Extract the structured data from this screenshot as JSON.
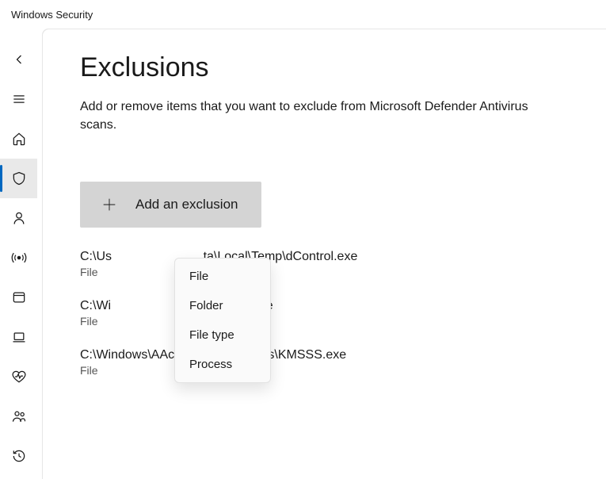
{
  "window": {
    "title": "Windows Security"
  },
  "sidebar": {
    "items": [
      {
        "name": "back",
        "icon": "arrow-left"
      },
      {
        "name": "menu",
        "icon": "menu"
      },
      {
        "name": "home",
        "icon": "home"
      },
      {
        "name": "virus-protection",
        "icon": "shield",
        "active": true
      },
      {
        "name": "account-protection",
        "icon": "person"
      },
      {
        "name": "firewall",
        "icon": "signal"
      },
      {
        "name": "app-browser",
        "icon": "window"
      },
      {
        "name": "device-security",
        "icon": "laptop"
      },
      {
        "name": "device-performance",
        "icon": "heart"
      },
      {
        "name": "family-options",
        "icon": "people"
      },
      {
        "name": "protection-history",
        "icon": "history"
      }
    ]
  },
  "page": {
    "title": "Exclusions",
    "description": "Add or remove items that you want to exclude from Microsoft Defender Antivirus scans."
  },
  "add_button": {
    "label": "Add an exclusion"
  },
  "dropdown": {
    "items": [
      {
        "label": "File"
      },
      {
        "label": "Folder"
      },
      {
        "label": "File type"
      },
      {
        "label": "Process"
      }
    ]
  },
  "exclusions": [
    {
      "path": "C:\\Users\\...\\AppData\\Local\\Temp\\dControl.exe",
      "type": "File"
    },
    {
      "path": "C:\\Windows\\AAct_Tools\\AAct.exe",
      "type": "File"
    },
    {
      "path": "C:\\Windows\\AAct_Tools\\AAct_files\\KMSSS.exe",
      "type": "File"
    }
  ],
  "exclusions_display": {
    "0": {
      "path": "C:\\Us                          ta\\Local\\Temp\\dControl.exe",
      "type": "File"
    },
    "1": {
      "path": "C:\\Wi                          ols\\AAct.exe",
      "type": "File"
    },
    "2": {
      "path": "C:\\Windows\\AAct_Tools\\AAct_files\\KMSSS.exe",
      "type": "File"
    }
  }
}
